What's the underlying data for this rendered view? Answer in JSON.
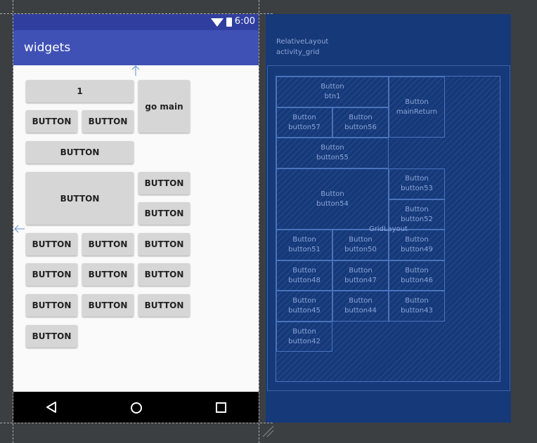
{
  "status_bar": {
    "time": "6:00"
  },
  "app_bar": {
    "title": "widgets"
  },
  "buttons": {
    "btn1": "1",
    "main_return": "go main",
    "button": "BUTTON"
  },
  "blueprint": {
    "layout_type": "RelativeLayout",
    "layout_id": "activity_grid",
    "grid_label": "GridLayout",
    "widget_type": "Button",
    "ids": {
      "btn1": "btn1",
      "mainReturn": "mainReturn",
      "button57": "button57",
      "button56": "button56",
      "button55": "button55",
      "button54": "button54",
      "button53": "button53",
      "button52": "button52",
      "button51": "button51",
      "button50": "button50",
      "button49": "button49",
      "button48": "button48",
      "button47": "button47",
      "button46": "button46",
      "button45": "button45",
      "button44": "button44",
      "button43": "button43",
      "button42": "button42"
    }
  },
  "colors": {
    "status_bar": "#303f9f",
    "app_bar": "#3f51b5",
    "blueprint_bg": "#163979",
    "editor_bg": "#3c3f41"
  }
}
